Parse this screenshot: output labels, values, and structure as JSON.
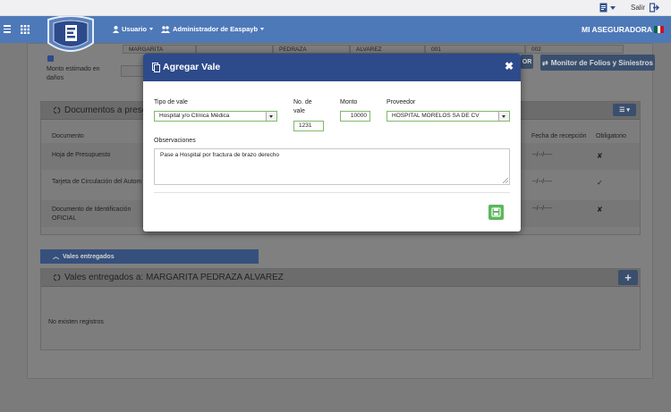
{
  "topbar": {
    "salir": "Salir"
  },
  "nav": {
    "usuario": "Usuario",
    "admin": "Administrador de Easpayb",
    "brand": "MI ASEGURADORA"
  },
  "background": {
    "name_cells": [
      "MARGARITA",
      "",
      "PEDRAZA",
      "ALVAREZ",
      "001",
      "002"
    ],
    "monto_label": "Monto estimado en daños",
    "monitor_btn": "Monitor de Folios y Siniestros",
    "btn_fragment": "OR",
    "docs_title": "Documentos a prese",
    "table_headers": {
      "documento": "Documento",
      "fecha": "Fecha de recepción",
      "obligatorio": "Obligatorio"
    },
    "docs": [
      {
        "name": "Hoja de Presupuesto",
        "fecha": "--/--/----",
        "oblig": "✘"
      },
      {
        "name": "Tarjeta de Circulación del Autom",
        "fecha": "--/--/----",
        "oblig": "✓"
      },
      {
        "name": "Documento de Identificación OFICIAL",
        "fecha": "--/--/----",
        "oblig": "✘"
      }
    ],
    "vales_tab": "Vales entregados",
    "vales_title": "Vales entregados a: MARGARITA PEDRAZA ALVAREZ",
    "no_records": "No existen registros"
  },
  "modal": {
    "title": "Agregar Vale",
    "tipo_label": "Tipo de vale",
    "tipo_value": "Hospital y/o Clínica Médica",
    "no_vale_label": "No. de vale",
    "no_vale_value": "1231",
    "monto_label": "Monto",
    "monto_value": "10000",
    "proveedor_label": "Proveedor",
    "proveedor_value": "HOSPITAL MORELOS SA DE CV",
    "obs_label": "Observaciones",
    "obs_value": "Pase a Hospital por fractura de brazo derecho"
  },
  "colors": {
    "nav": "#4e79b8",
    "modal_header": "#2d4a8a",
    "save": "#5cb85c",
    "field_border": "#7fb86a",
    "overlay": "#7b7b7b"
  },
  "icons": [
    "document-icon",
    "exit-icon",
    "hamburger-icon",
    "apps-grid-icon",
    "user-icon",
    "users-icon",
    "mexico-flag-icon",
    "copy-icon",
    "close-icon",
    "save-icon",
    "list-icon",
    "plus-icon",
    "chevron-up-icon",
    "refresh-icon",
    "monitor-icon"
  ]
}
